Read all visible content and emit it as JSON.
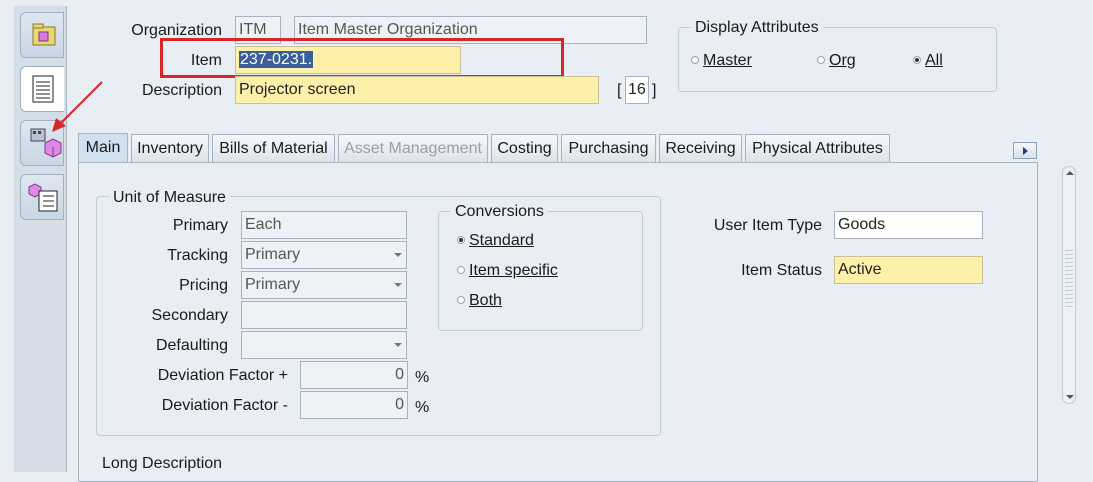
{
  "header": {
    "organization_label": "Organization",
    "organization_code": "ITM",
    "organization_name": "Item Master Organization",
    "item_label": "Item",
    "item_value": "237-0231.",
    "description_label": "Description",
    "description_value": "Projector screen",
    "desc_bracket_open": "[",
    "desc_bracket_value": "16",
    "desc_bracket_close": "]"
  },
  "display_attributes": {
    "title": "Display Attributes",
    "options": [
      {
        "label": "Master",
        "selected": false
      },
      {
        "label": "Org",
        "selected": false
      },
      {
        "label": "All",
        "selected": true
      }
    ]
  },
  "tabs": [
    {
      "label": "Main",
      "state": "active"
    },
    {
      "label": "Inventory",
      "state": "normal"
    },
    {
      "label": "Bills of Material",
      "state": "normal"
    },
    {
      "label": "Asset Management",
      "state": "disabled"
    },
    {
      "label": "Costing",
      "state": "normal"
    },
    {
      "label": "Purchasing",
      "state": "normal"
    },
    {
      "label": "Receiving",
      "state": "normal"
    },
    {
      "label": "Physical Attributes",
      "state": "normal"
    }
  ],
  "uom": {
    "title": "Unit of Measure",
    "primary_label": "Primary",
    "primary_value": "Each",
    "tracking_label": "Tracking",
    "tracking_value": "Primary",
    "pricing_label": "Pricing",
    "pricing_value": "Primary",
    "secondary_label": "Secondary",
    "secondary_value": "",
    "defaulting_label": "Defaulting",
    "defaulting_value": "",
    "dev_plus_label": "Deviation Factor +",
    "dev_plus_value": "0",
    "dev_minus_label": "Deviation Factor -",
    "dev_minus_value": "0",
    "percent": "%"
  },
  "conversions": {
    "title": "Conversions",
    "options": [
      {
        "label": "Standard",
        "selected": true
      },
      {
        "label": "Item specific",
        "selected": false
      },
      {
        "label": "Both",
        "selected": false
      }
    ]
  },
  "item_info": {
    "user_item_type_label": "User Item Type",
    "user_item_type_value": "Goods",
    "item_status_label": "Item Status",
    "item_status_value": "Active"
  },
  "long_description_label": "Long Description",
  "colors": {
    "highlight_box": "#d62828",
    "arrow": "#d62828",
    "required_field": "#fdf0a8",
    "active_tab": "#cfe0ee"
  }
}
